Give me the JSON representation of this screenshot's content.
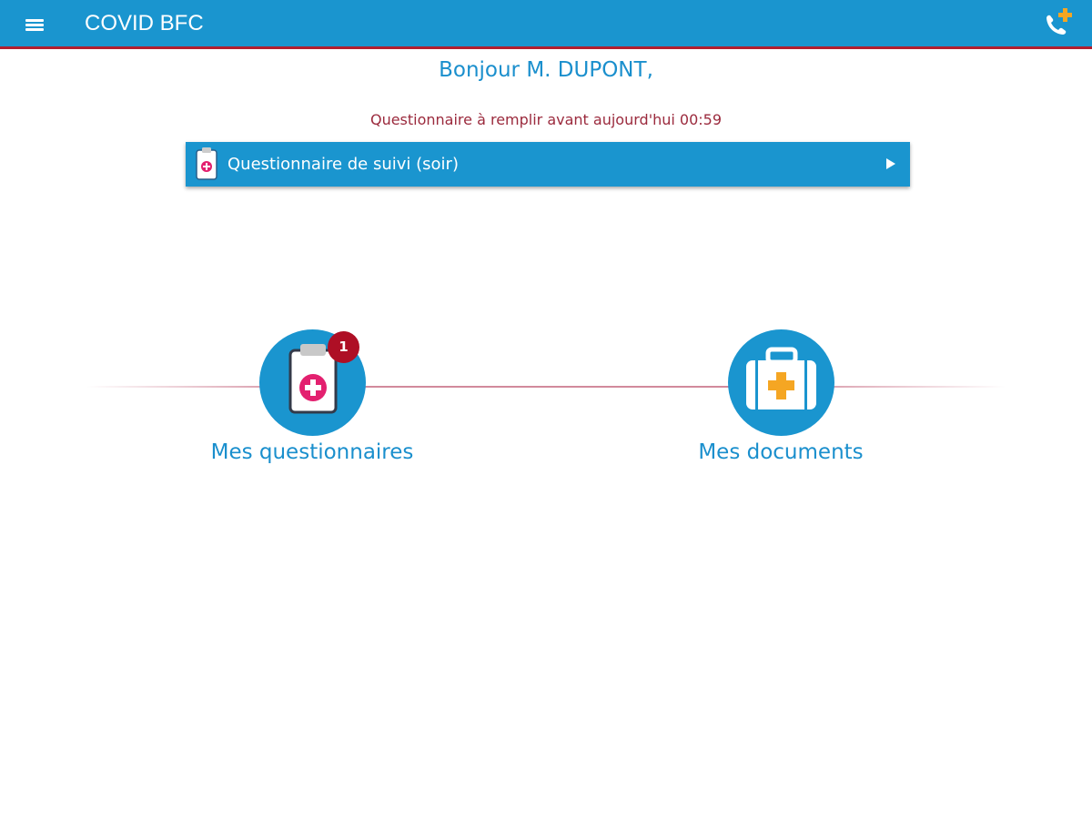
{
  "app": {
    "title": "COVID BFC",
    "menu_icon": "hamburger-menu-icon",
    "call_icon": "phone-plus-icon"
  },
  "greeting": "Bonjour M. DUPONT,",
  "deadline_text": "Questionnaire à remplir avant aujourd'hui 00:59",
  "pending_questionnaire": {
    "label": "Questionnaire de suivi (soir)",
    "icon": "clipboard-medical-icon",
    "arrow_icon": "play-arrow-icon"
  },
  "tiles": [
    {
      "label": "Mes questionnaires",
      "icon": "clipboard-medical-icon",
      "badge": "1"
    },
    {
      "label": "Mes documents",
      "icon": "medical-kit-icon"
    }
  ],
  "colors": {
    "primary": "#1a95cf",
    "accent_red": "#b11e2f",
    "badge_red": "#ae0f25",
    "deadline_text": "#9b2a3d",
    "medical_pink": "#e3206f",
    "medical_orange": "#f5a623"
  }
}
